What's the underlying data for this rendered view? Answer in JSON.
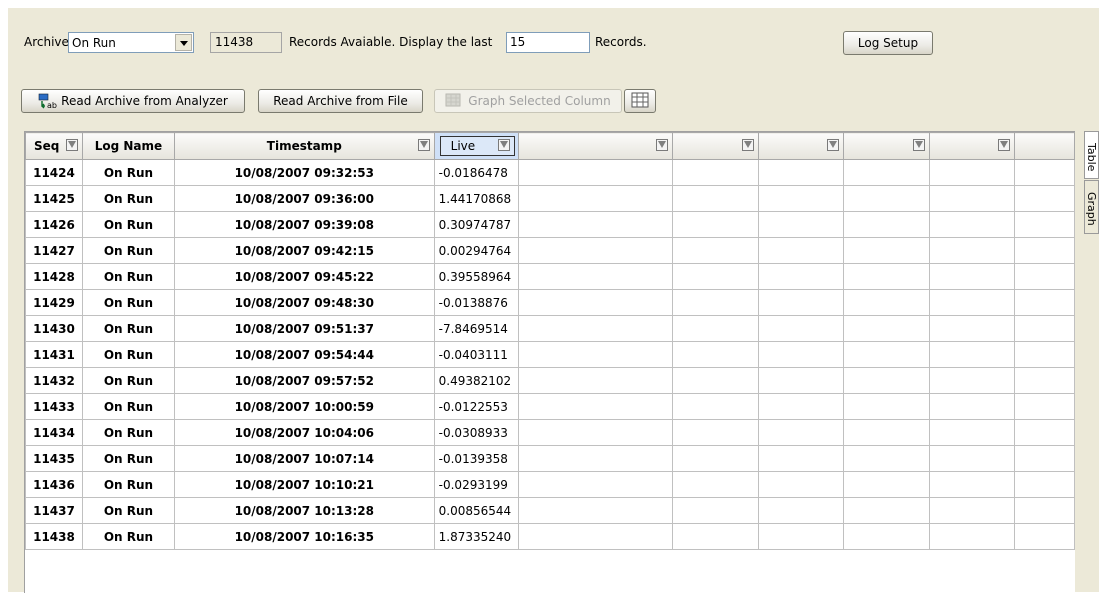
{
  "toolbar": {
    "archive_label": "Archive:",
    "archive_selected": "On Run",
    "record_count": "11438",
    "records_available_text": "Records Avaiable. Display the last",
    "display_last_value": "15",
    "records_label": "Records.",
    "log_setup_label": "Log Setup",
    "read_analyzer_label": "Read Archive from Analyzer",
    "read_file_label": "Read Archive from File",
    "graph_selected_label": "Graph Selected Column"
  },
  "table": {
    "headers": [
      "Seq",
      "Log Name",
      "Timestamp",
      "Live",
      "",
      "",
      "",
      "",
      ""
    ],
    "rows": [
      [
        "11424",
        "On Run",
        "10/08/2007 09:32:53",
        "-0.0186478"
      ],
      [
        "11425",
        "On Run",
        "10/08/2007 09:36:00",
        "1.44170868"
      ],
      [
        "11426",
        "On Run",
        "10/08/2007 09:39:08",
        "0.30974787"
      ],
      [
        "11427",
        "On Run",
        "10/08/2007 09:42:15",
        "0.00294764"
      ],
      [
        "11428",
        "On Run",
        "10/08/2007 09:45:22",
        "0.39558964"
      ],
      [
        "11429",
        "On Run",
        "10/08/2007 09:48:30",
        "-0.0138876"
      ],
      [
        "11430",
        "On Run",
        "10/08/2007 09:51:37",
        "-7.8469514"
      ],
      [
        "11431",
        "On Run",
        "10/08/2007 09:54:44",
        "-0.0403111"
      ],
      [
        "11432",
        "On Run",
        "10/08/2007 09:57:52",
        "0.49382102"
      ],
      [
        "11433",
        "On Run",
        "10/08/2007 10:00:59",
        "-0.0122553"
      ],
      [
        "11434",
        "On Run",
        "10/08/2007 10:04:06",
        "-0.0308933"
      ],
      [
        "11435",
        "On Run",
        "10/08/2007 10:07:14",
        "-0.0139358"
      ],
      [
        "11436",
        "On Run",
        "10/08/2007 10:10:21",
        "-0.0293199"
      ],
      [
        "11437",
        "On Run",
        "10/08/2007 10:13:28",
        "0.00856544"
      ],
      [
        "11438",
        "On Run",
        "10/08/2007 10:16:35",
        "1.87335240"
      ]
    ]
  },
  "side_tabs": [
    "Table",
    "Graph"
  ],
  "icons": {
    "read_analyzer": "analyzer-download-icon",
    "graph_selected": "graph-icon",
    "grid_toggle": "grid-icon",
    "filter": "filter-funnel-icon"
  },
  "colors": {
    "panel_bg": "#ece9d8",
    "selected_header": "#cfe0f7"
  }
}
